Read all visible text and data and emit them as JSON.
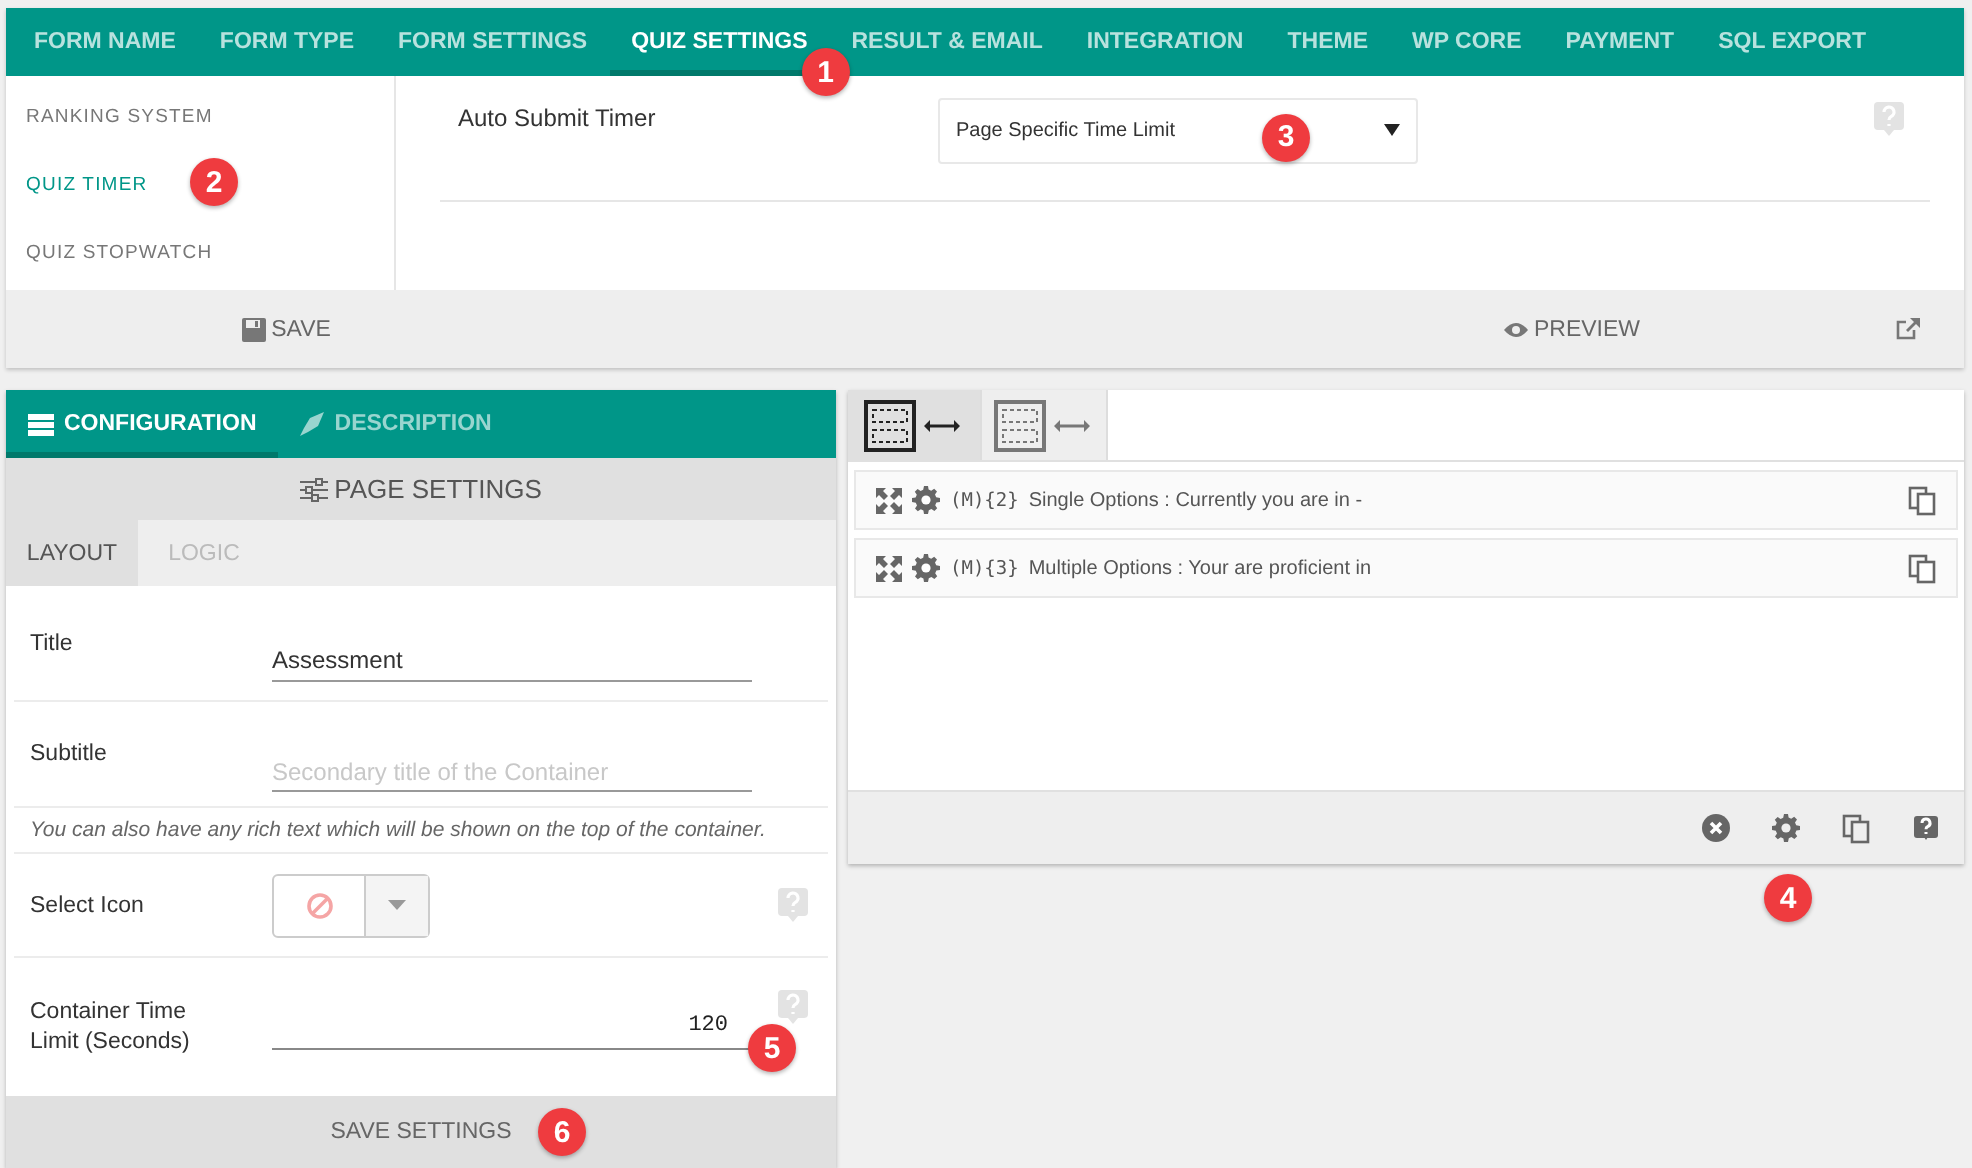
{
  "nav_tabs": [
    {
      "label": "FORM NAME",
      "selected": false
    },
    {
      "label": "FORM TYPE",
      "selected": false
    },
    {
      "label": "FORM SETTINGS",
      "selected": false
    },
    {
      "label": "QUIZ SETTINGS",
      "selected": true,
      "callout": "1"
    },
    {
      "label": "RESULT & EMAIL",
      "selected": false
    },
    {
      "label": "INTEGRATION",
      "selected": false
    },
    {
      "label": "THEME",
      "selected": false
    },
    {
      "label": "WP CORE",
      "selected": false
    },
    {
      "label": "PAYMENT",
      "selected": false
    },
    {
      "label": "SQL EXPORT",
      "selected": false
    }
  ],
  "quiz_settings": {
    "sidebar": [
      {
        "label": "RANKING SYSTEM",
        "selected": false
      },
      {
        "label": "QUIZ TIMER",
        "selected": true,
        "callout": "2"
      },
      {
        "label": "QUIZ STOPWATCH",
        "selected": false
      }
    ],
    "field": {
      "label": "Auto Submit Timer",
      "value": "Page Specific Time Limit",
      "callout": "3"
    },
    "actions": [
      {
        "kind": "save",
        "label": "SAVE"
      },
      {
        "kind": "preview",
        "label": "PREVIEW"
      },
      {
        "kind": "external"
      }
    ]
  },
  "config": {
    "tabs": [
      {
        "kind": "configuration",
        "label": "CONFIGURATION",
        "selected": true
      },
      {
        "kind": "description",
        "label": "DESCRIPTION",
        "selected": false
      }
    ],
    "header": "PAGE SETTINGS",
    "subtabs": [
      {
        "label": "LAYOUT",
        "selected": true
      },
      {
        "label": "LOGIC",
        "selected": false
      }
    ],
    "fields": [
      {
        "kind": "text",
        "label": "Title",
        "value": "Assessment",
        "help": false
      },
      {
        "kind": "text",
        "label": "Subtitle",
        "placeholder": "Secondary title of the Container",
        "help": false
      },
      {
        "kind": "note",
        "text": "You can also have any rich text which will be shown on the top of the container."
      },
      {
        "kind": "icon",
        "label": "Select Icon",
        "help": true
      },
      {
        "kind": "number",
        "label": "Container Time Limit (Seconds)",
        "value": "120",
        "help": true,
        "callout": "5"
      }
    ],
    "save": {
      "label": "SAVE SETTINGS",
      "callout": "6"
    }
  },
  "builder": {
    "layouts": [
      {
        "selected": true
      },
      {
        "selected": false
      }
    ],
    "elements": [
      {
        "code": "(M){2}",
        "label": "Single Options : Currently you are in -"
      },
      {
        "code": "(M){3}",
        "label": "Multiple Options : Your are proficient in"
      }
    ],
    "tools": [
      {
        "kind": "close"
      },
      {
        "kind": "settings",
        "callout": "4"
      },
      {
        "kind": "copy"
      },
      {
        "kind": "help"
      }
    ]
  }
}
